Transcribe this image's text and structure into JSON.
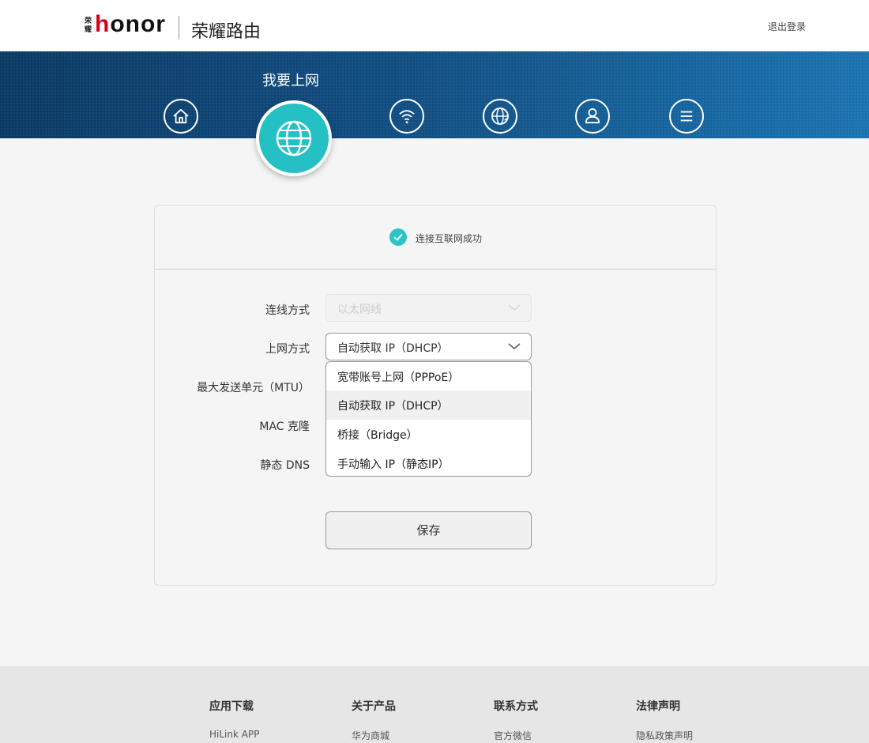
{
  "header": {
    "logo_mark": [
      "荣",
      "耀"
    ],
    "logo_text_h": "h",
    "logo_text_rest": "onor",
    "product_title": "荣耀路由",
    "logout_label": "退出登录"
  },
  "nav": {
    "active_title": "我要上网",
    "icons": [
      "home-icon",
      "globe-icon",
      "wifi-icon",
      "network-settings-icon",
      "user-icon",
      "menu-icon"
    ],
    "active_index": 1
  },
  "status": {
    "text": "连接互联网成功",
    "color": "#2ec4c6"
  },
  "form": {
    "connection_label": "连线方式",
    "connection_value": "以太网线",
    "internet_label": "上网方式",
    "internet_value": "自动获取 IP（DHCP）",
    "mtu_label": "最大发送单元（MTU）",
    "mac_label": "MAC 克隆",
    "dns_label": "静态 DNS",
    "options": [
      "宽带账号上网（PPPoE）",
      "自动获取 IP（DHCP）",
      "桥接（Bridge）",
      "手动输入 IP（静态IP）"
    ],
    "selected_option_index": 1,
    "save_label": "保存"
  },
  "footer": {
    "columns": [
      {
        "title": "应用下载",
        "link": "HiLink APP"
      },
      {
        "title": "关于产品",
        "link": "华为商城"
      },
      {
        "title": "联系方式",
        "link": "官方微信"
      },
      {
        "title": "法律声明",
        "link": "隐私政策声明"
      }
    ]
  },
  "colors": {
    "accent": "#24c0c4",
    "banner_dark": "#0b3a64",
    "banner_light": "#1a73b0",
    "brand_red": "#d6001c"
  }
}
